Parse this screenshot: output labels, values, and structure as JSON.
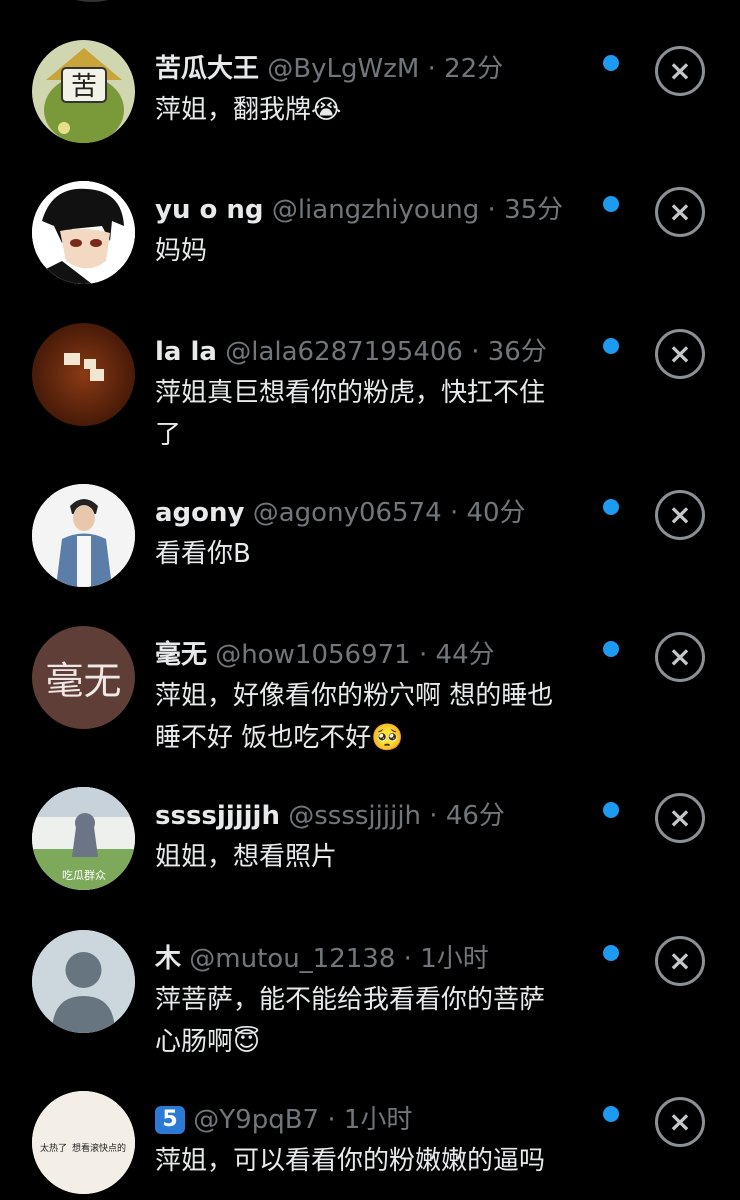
{
  "colors": {
    "background": "#000000",
    "unread": "#1d9bf0",
    "secondary": "#71767b",
    "primary_text": "#e7e9ea"
  },
  "dismiss_icon": "close-x-icon",
  "comments": [
    {
      "name": "苦瓜大王",
      "handle": "@ByLgWzM",
      "dot": "·",
      "time": "22分",
      "text": "萍姐，翻我牌😭",
      "avatar_glyph": "苦"
    },
    {
      "name": "yu o ng",
      "handle": "@liangzhiyoung",
      "dot": "·",
      "time": "35分",
      "text": "妈妈"
    },
    {
      "name": "la la",
      "handle": "@lala6287195406",
      "dot": "·",
      "time": "36分",
      "text_line1": "萍姐真巨想看你的粉虎，快扛不住",
      "text_line2": "了"
    },
    {
      "name": "agony",
      "handle": "@agony06574",
      "dot": "·",
      "time": "40分",
      "text": "看看你B"
    },
    {
      "name": "毫无",
      "handle": "@how1056971",
      "dot": "·",
      "time": "44分",
      "text_line1": "萍姐，好像看你的粉穴啊 想的睡也",
      "text_line2": "睡不好 饭也吃不好🥺",
      "avatar_text": "毫无"
    },
    {
      "name": "ssssjjjjjh",
      "handle": "@ssssjjjjjh",
      "dot": "·",
      "time": "46分",
      "text": "姐姐，想看照片",
      "avatar_caption": "吃瓜群众"
    },
    {
      "name": "木",
      "handle": "@mutou_12138",
      "dot": "·",
      "time": "1小时",
      "text_line1": "萍菩萨，能不能给我看看你的菩萨",
      "text_line2": "心肠啊😇"
    },
    {
      "name": "5",
      "handle": "@Y9pqB7",
      "dot": "·",
      "time": "1小时",
      "text": "萍姐，可以看看你的粉嫩嫩的逼吗",
      "avatar_text_a": "太热了",
      "avatar_text_b": "想看滚快点的"
    }
  ]
}
